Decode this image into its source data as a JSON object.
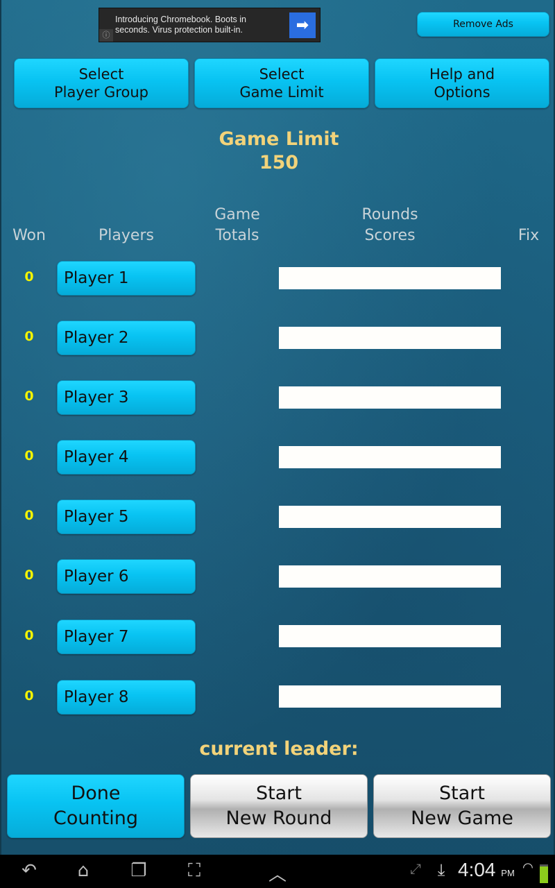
{
  "ad": {
    "text_line1": "Introducing Chromebook. Boots in",
    "text_line2": "seconds. Virus protection built-in.",
    "arrow_icon": "➡",
    "info_icon": "ⓘ"
  },
  "header": {
    "remove_ads": "Remove Ads",
    "buttons": [
      {
        "line1": "Select",
        "line2": "Player Group"
      },
      {
        "line1": "Select",
        "line2": "Game Limit"
      },
      {
        "line1": "Help and",
        "line2": "Options"
      }
    ]
  },
  "game_limit": {
    "label": "Game Limit",
    "value": "150"
  },
  "columns": {
    "won": "Won",
    "players": "Players",
    "game_totals_1": "Game",
    "game_totals_2": "Totals",
    "rounds_scores_1": "Rounds",
    "rounds_scores_2": "Scores",
    "fix": "Fix"
  },
  "players": [
    {
      "won": "0",
      "name": "Player 1",
      "total": "",
      "round_score": ""
    },
    {
      "won": "0",
      "name": "Player 2",
      "total": "",
      "round_score": ""
    },
    {
      "won": "0",
      "name": "Player 3",
      "total": "",
      "round_score": ""
    },
    {
      "won": "0",
      "name": "Player 4",
      "total": "",
      "round_score": ""
    },
    {
      "won": "0",
      "name": "Player 5",
      "total": "",
      "round_score": ""
    },
    {
      "won": "0",
      "name": "Player 6",
      "total": "",
      "round_score": ""
    },
    {
      "won": "0",
      "name": "Player 7",
      "total": "",
      "round_score": ""
    },
    {
      "won": "0",
      "name": "Player 8",
      "total": "",
      "round_score": ""
    }
  ],
  "leader": {
    "label": "current leader:",
    "name": ""
  },
  "bottom": [
    {
      "line1": "Done",
      "line2": "Counting"
    },
    {
      "line1": "Start",
      "line2": "New Round"
    },
    {
      "line1": "Start",
      "line2": "New Game"
    }
  ],
  "statusbar": {
    "time": "4:04",
    "ampm": "PM",
    "icons": {
      "back": "↶",
      "home": "⌂",
      "recent": "❐",
      "screenshot": "⛶",
      "up": "︿",
      "expand": "⤢",
      "download": "⤓",
      "wifi": "◠"
    }
  }
}
